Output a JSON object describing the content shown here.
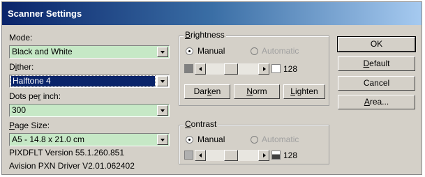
{
  "window": {
    "title": "Scanner Settings"
  },
  "mode": {
    "label": "Mode:",
    "value": "Black and White"
  },
  "dither": {
    "label_pre": "D",
    "label_ul": "i",
    "label_post": "ther:",
    "value": "Halftone 4"
  },
  "dpi": {
    "label_pre": "Dots pe",
    "label_ul": "r",
    "label_post": " inch:",
    "value": "300"
  },
  "page_size": {
    "label_pre": "",
    "label_ul": "P",
    "label_post": "age Size:",
    "value": "A5 - 14.8 x 21.0 cm"
  },
  "info": {
    "version": "PIXDFLT Version 55.1.260.851",
    "driver": "Avision PXN Driver V2.01.062402"
  },
  "brightness": {
    "legend_ul": "B",
    "legend_rest": "rightness",
    "manual_label": "Manual",
    "automatic_label": "Automatic",
    "manual_selected": true,
    "value": "128",
    "buttons": {
      "darken_pre": "Dar",
      "darken_ul": "k",
      "darken_post": "en",
      "norm_pre": "",
      "norm_ul": "N",
      "norm_post": "orm",
      "lighten_pre": "",
      "lighten_ul": "L",
      "lighten_post": "ighten"
    },
    "swatch_left_color": "#808080",
    "swatch_right_color": "#ffffff"
  },
  "contrast": {
    "legend_ul": "C",
    "legend_rest": "ontrast",
    "manual_label": "Manual",
    "automatic_label": "Automatic",
    "manual_selected": true,
    "value": "128",
    "swatch_left_color": "#b0b0b0",
    "swatch_right_color": "#404040"
  },
  "actions": {
    "ok": "OK",
    "default_ul": "D",
    "default_rest": "efault",
    "cancel": "Cancel",
    "area_ul": "A",
    "area_rest": "rea..."
  }
}
